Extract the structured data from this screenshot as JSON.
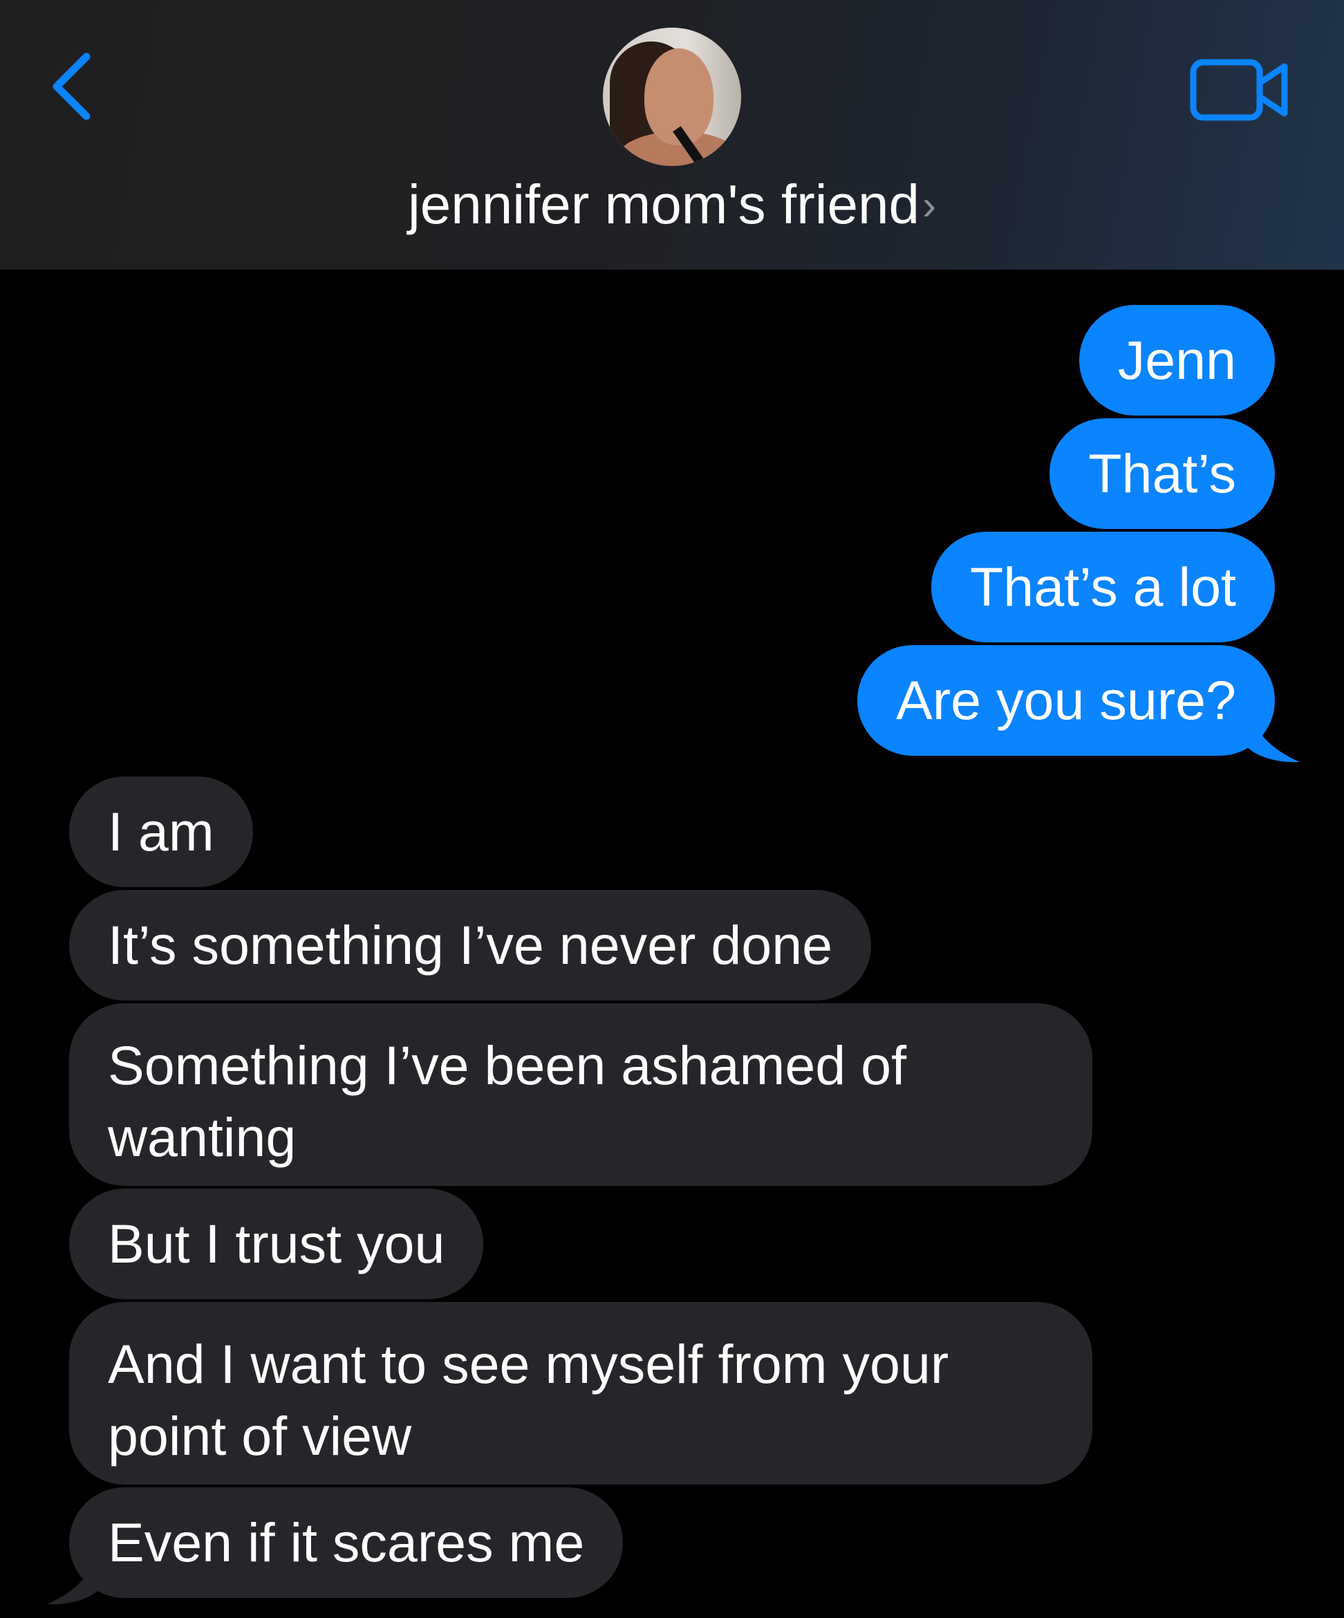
{
  "header": {
    "contact_name": "jennifer mom's friend",
    "chevron": "›",
    "back_icon": "chevron-left-icon",
    "video_icon": "video-camera-icon"
  },
  "colors": {
    "accent": "#0b84ff",
    "incoming_bubble": "#26262a",
    "background": "#000000"
  },
  "messages": [
    {
      "direction": "outgoing",
      "text": "Jenn"
    },
    {
      "direction": "outgoing",
      "text": "That’s"
    },
    {
      "direction": "outgoing",
      "text": "That’s a lot"
    },
    {
      "direction": "outgoing",
      "text": "Are you sure?"
    },
    {
      "direction": "incoming",
      "text": "I am"
    },
    {
      "direction": "incoming",
      "text": "It’s something I’ve never done"
    },
    {
      "direction": "incoming",
      "text": "Something I’ve been ashamed of wanting"
    },
    {
      "direction": "incoming",
      "text": "But I trust you"
    },
    {
      "direction": "incoming",
      "text": "And I want to see myself from your point of view"
    },
    {
      "direction": "incoming",
      "text": "Even if it scares me"
    }
  ]
}
